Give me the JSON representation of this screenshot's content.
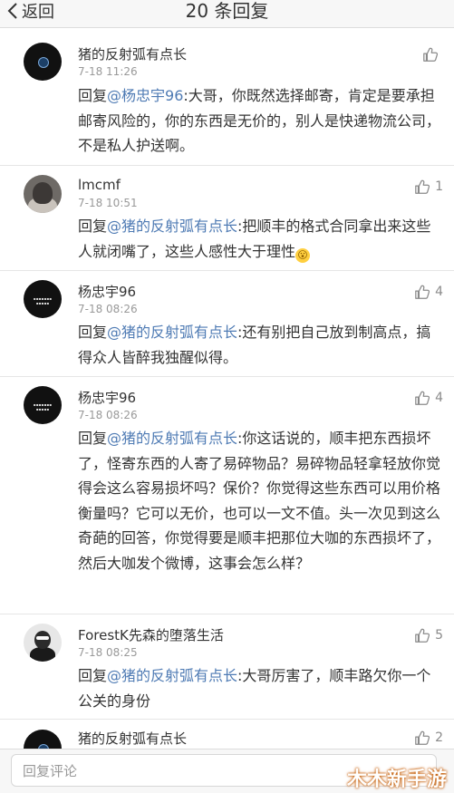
{
  "nav": {
    "back_label": "返回",
    "title": "20 条回复"
  },
  "comments": [
    {
      "name": "猪的反射弧有点长",
      "time": "7-18 11:26",
      "likes": "",
      "prefix": "回复",
      "mention": "@杨忠宇96",
      "content": ":大哥，你既然选择邮寄，肯定是要承担邮寄风险的，你的东西是无价的，别人是快递物流公司，不是私人护送啊。"
    },
    {
      "name": "lmcmf",
      "time": "7-18 10:51",
      "likes": "1",
      "prefix": "回复",
      "mention": "@猪的反射弧有点长",
      "content": ":把顺丰的格式合同拿出来这些人就闭嘴了，这些人感性大于理性",
      "emoji": "😮"
    },
    {
      "name": "杨忠宇96",
      "time": "7-18 08:26",
      "likes": "4",
      "prefix": "回复",
      "mention": "@猪的反射弧有点长",
      "content": ":还有别把自己放到制高点，搞得众人皆醉我独醒似得。"
    },
    {
      "name": "杨忠宇96",
      "time": "7-18 08:26",
      "likes": "4",
      "prefix": "回复",
      "mention": "@猪的反射弧有点长",
      "content": ":你这话说的，顺丰把东西损坏了，怪寄东西的人寄了易碎物品？易碎物品轻拿轻放你觉得会这么容易损坏吗？保价？你觉得这些东西可以用价格衡量吗？它可以无价，也可以一文不值。头一次见到这么奇葩的回答，你觉得要是顺丰把那位大咖的东西损坏了，然后大咖发个微博，这事会怎么样？"
    },
    {
      "name": "ForestK先森的堕落生活",
      "time": "7-18 08:25",
      "likes": "5",
      "prefix": "回复",
      "mention": "@猪的反射弧有点长",
      "content": ":大哥厉害了，顺丰路欠你一个公关的身份"
    },
    {
      "name": "猪的反射弧有点长",
      "time": "",
      "likes": "2"
    }
  ],
  "bottom": {
    "reply_placeholder": "回复评论"
  },
  "watermark": "木木新手游"
}
